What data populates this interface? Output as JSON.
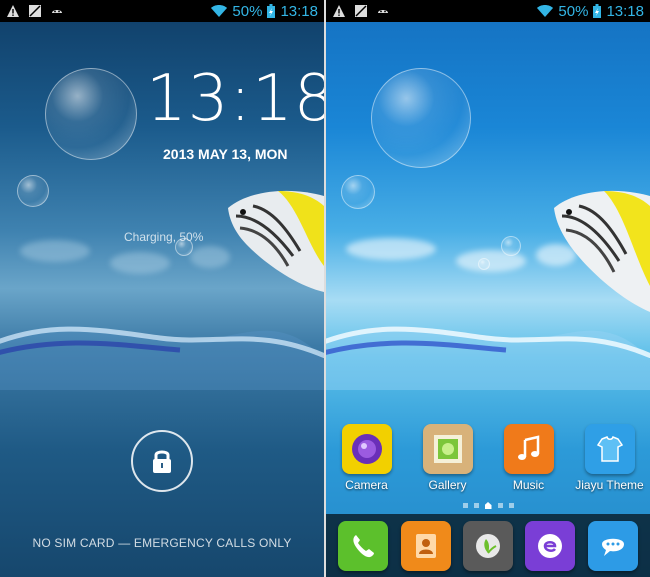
{
  "status_bar": {
    "battery_percent": "50%",
    "time": "13:18",
    "left_icons": [
      "warning-icon",
      "sim-icon",
      "android-icon"
    ],
    "right_icons": [
      "wifi-icon",
      "battery-charging-icon"
    ]
  },
  "lock_screen": {
    "clock": "13:18",
    "date": "2013 MAY 13, MON",
    "charging": "Charging, 50%",
    "unlock_icon": "padlock-icon",
    "carrier_text": "NO SIM CARD — EMERGENCY CALLS ONLY"
  },
  "home_screen": {
    "apps": [
      {
        "label": "Camera",
        "icon": "camera-icon",
        "color": "#f2d000"
      },
      {
        "label": "Gallery",
        "icon": "gallery-icon",
        "color": "#d8b27a"
      },
      {
        "label": "Music",
        "icon": "music-icon",
        "color": "#f07a1a"
      },
      {
        "label": "Jiayu Theme",
        "icon": "theme-icon",
        "color": "#2f9fe6"
      }
    ],
    "pages": 5,
    "current_page": 3,
    "dock": [
      {
        "icon": "phone-icon",
        "color": "#5cc02c"
      },
      {
        "icon": "contacts-icon",
        "color": "#f08a1a"
      },
      {
        "icon": "app-drawer-icon",
        "color": "#5a5a5a"
      },
      {
        "icon": "browser-icon",
        "color": "#7a3ed6"
      },
      {
        "icon": "messaging-icon",
        "color": "#2d9be6"
      }
    ]
  },
  "colors": {
    "accent": "#33b5e5"
  }
}
